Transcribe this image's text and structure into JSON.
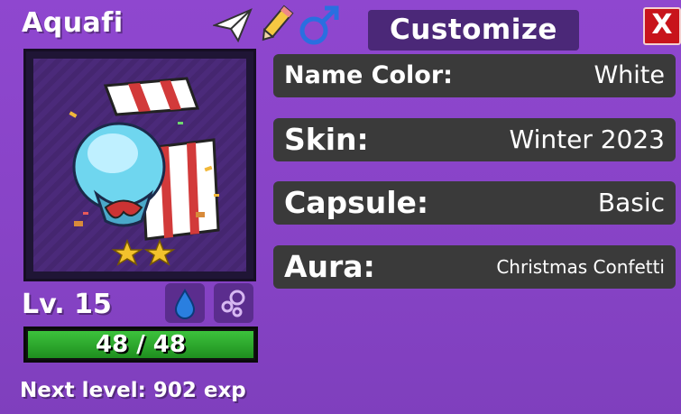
{
  "pet": {
    "name": "Aquafi",
    "level_text": "Lv. 15",
    "hp_text": "48 / 48",
    "hp_fraction": 1.0,
    "next_level_text": "Next level: 902 exp",
    "stars": 2
  },
  "header": {
    "customize_label": "Customize",
    "close_label": "X",
    "icons": [
      "paper-plane-icon",
      "pencil-icon",
      "male-gender-icon"
    ]
  },
  "rows": [
    {
      "label": "Name Color:",
      "value": "White"
    },
    {
      "label": "Skin:",
      "value": "Winter 2023"
    },
    {
      "label": "Capsule:",
      "value": "Basic"
    },
    {
      "label": "Aura:",
      "value": "Christmas Confetti"
    }
  ],
  "element_buttons": [
    "water-drop-icon",
    "bubbles-icon"
  ],
  "colors": {
    "panel": "#8a44c8",
    "row_bg": "#3a3a3a",
    "customize_bg": "#4b2878",
    "close_bg": "#c8141b",
    "hp_fill": "#2fae2f",
    "male_icon": "#2a6fe0"
  }
}
